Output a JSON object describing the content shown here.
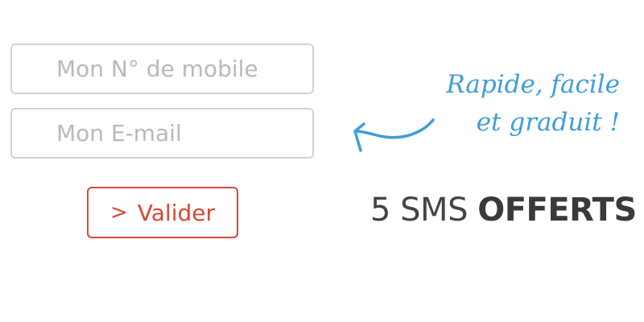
{
  "form": {
    "mobile_placeholder": "Mon N° de mobile",
    "email_placeholder": "Mon E-mail",
    "submit_label": "Valider",
    "submit_icon": "chevron-right-icon"
  },
  "promo": {
    "handwritten_line1": "Rapide, facile",
    "handwritten_line2": "et graduit !",
    "arrow_icon": "curved-arrow-left-icon",
    "offer_prefix": "5 SMS",
    "offer_bold": "OFFERTS"
  },
  "colors": {
    "accent_red": "#d5483a",
    "handwriting_blue": "#3d9fd6",
    "field_border": "#d2d2d2",
    "placeholder_gray": "#b9b9b9"
  }
}
